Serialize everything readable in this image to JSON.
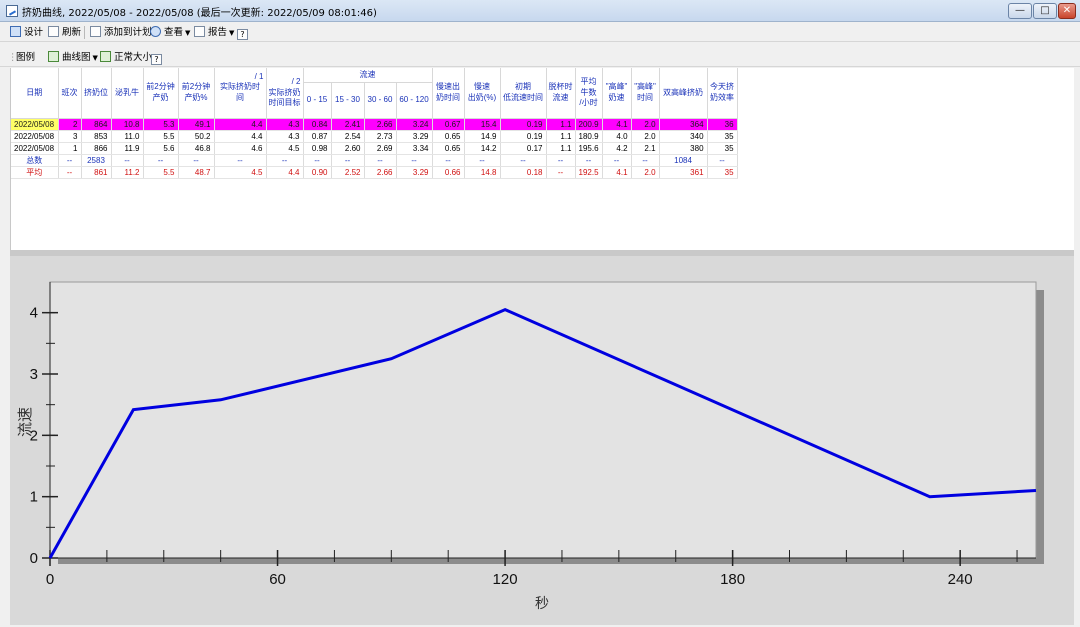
{
  "window": {
    "title": "挤奶曲线, 2022/05/08 - 2022/05/08 (最后一次更新: 2022/05/09 08:01:46)",
    "btn_minimize": "—",
    "btn_maximize": "□",
    "btn_close": "✕"
  },
  "toolbar1": {
    "design": "设计",
    "refresh": "刷新",
    "add_plan": "添加到计划",
    "view": "查看",
    "report": "报告",
    "help": "?"
  },
  "toolbar2": {
    "legend": "图例",
    "curve": "曲线图",
    "normal_size": "正常大小",
    "help": "?"
  },
  "table": {
    "headers": {
      "date": "日期",
      "shift": "班次",
      "stall": "挤奶位",
      "lactating": "泌乳牛",
      "first2min_yield_1": "前2分钟",
      "first2min_yield_2": "产奶",
      "first2min_pct_1": "前2分钟",
      "first2min_pct_2": "产奶%",
      "actual_time_mark": "/ 1",
      "actual_time": "实际挤奶时间",
      "target_time_mark": "/ 2",
      "target_time_1": "实际挤奶",
      "target_time_2": "时间目标",
      "flow_group": "流速",
      "flow_0_15": "0 - 15",
      "flow_15_30": "15 - 30",
      "flow_30_60": "30 - 60",
      "flow_60_120": "60 - 120",
      "slow_time_1": "慢速出",
      "slow_time_2": "奶时间",
      "slow_pct_1": "慢速",
      "slow_pct_2": "出奶(%)",
      "initial_low_1": "初期",
      "initial_low_2": "低流速时间",
      "detach_1": "脱杯时",
      "detach_2": "流速",
      "avg_cows_1": "平均",
      "avg_cows_2": "牛数",
      "avg_cows_3": "/小时",
      "peak_speed_1": "\"高峰\"",
      "peak_speed_2": "奶速",
      "peak_time_1": "\"高峰\"",
      "peak_time_2": "时间",
      "double_peak": "双高峰挤奶",
      "efficiency_1": "今天挤",
      "efficiency_2": "奶效率"
    },
    "rows": [
      [
        "2022/05/08",
        "2",
        "864",
        "10.8",
        "5.3",
        "49.1",
        "4.4",
        "4.3",
        "0.84",
        "2.41",
        "2.66",
        "3.24",
        "0.67",
        "15.4",
        "0.19",
        "1.1",
        "200.9",
        "4.1",
        "2.0",
        "364",
        "36"
      ],
      [
        "2022/05/08",
        "3",
        "853",
        "11.0",
        "5.5",
        "50.2",
        "4.4",
        "4.3",
        "0.87",
        "2.54",
        "2.73",
        "3.29",
        "0.65",
        "14.9",
        "0.19",
        "1.1",
        "180.9",
        "4.0",
        "2.0",
        "340",
        "35"
      ],
      [
        "2022/05/08",
        "1",
        "866",
        "11.9",
        "5.6",
        "46.8",
        "4.6",
        "4.5",
        "0.98",
        "2.60",
        "2.69",
        "3.34",
        "0.65",
        "14.2",
        "0.17",
        "1.1",
        "195.6",
        "4.2",
        "2.1",
        "380",
        "35"
      ]
    ],
    "total": [
      "总数",
      "--",
      "2583",
      "--",
      "--",
      "--",
      "--",
      "--",
      "--",
      "--",
      "--",
      "--",
      "--",
      "--",
      "--",
      "--",
      "--",
      "--",
      "--",
      "1084",
      "--"
    ],
    "average": [
      "平均",
      "--",
      "861",
      "11.2",
      "5.5",
      "48.7",
      "4.5",
      "4.4",
      "0.90",
      "2.52",
      "2.66",
      "3.29",
      "0.66",
      "14.8",
      "0.18",
      "--",
      "192.5",
      "4.1",
      "2.0",
      "361",
      "35"
    ]
  },
  "colors": {
    "selected_row": "#ff00ff",
    "selected_date_cell": "#ffff66",
    "header_text": "#1a32b8",
    "average_text": "#d01010",
    "curve": "#0000e0"
  },
  "chart_data": {
    "type": "line",
    "xlabel": "秒",
    "ylabel": "流速",
    "xlim": [
      0,
      260
    ],
    "ylim": [
      0,
      4.5
    ],
    "x_ticks": [
      0,
      60,
      120,
      180,
      240
    ],
    "y_ticks": [
      0,
      1,
      2,
      3,
      4
    ],
    "x": [
      0,
      22,
      45,
      90,
      120,
      232,
      260
    ],
    "series": [
      {
        "values": [
          0,
          2.42,
          2.58,
          3.25,
          4.05,
          1.0,
          1.1
        ]
      }
    ],
    "grid": false,
    "background": "#e3e3e3"
  }
}
